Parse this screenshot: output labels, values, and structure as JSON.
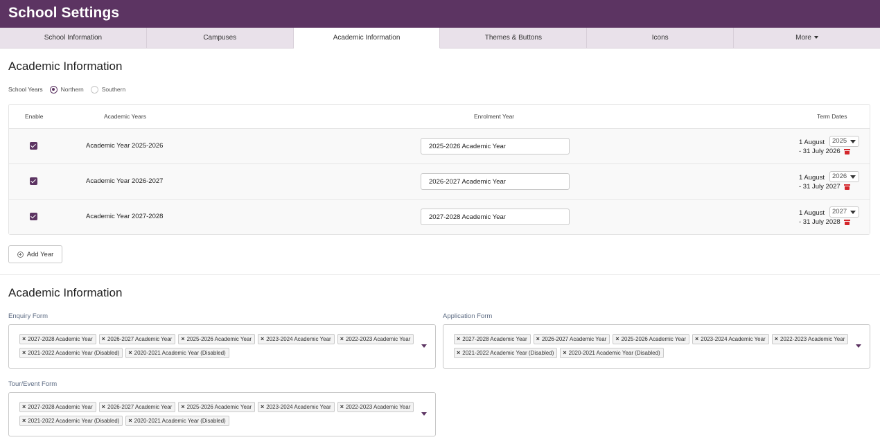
{
  "header": {
    "title": "School Settings"
  },
  "tabs": [
    {
      "label": "School Information",
      "active": false
    },
    {
      "label": "Campuses",
      "active": false
    },
    {
      "label": "Academic Information",
      "active": true
    },
    {
      "label": "Themes & Buttons",
      "active": false
    },
    {
      "label": "Icons",
      "active": false
    },
    {
      "label": "More",
      "active": false
    }
  ],
  "academic": {
    "title": "Academic Information",
    "school_years_label": "School Years",
    "hemisphere_options": [
      "Northern",
      "Southern"
    ],
    "hemisphere_selected": "Northern",
    "table": {
      "columns": {
        "enable": "Enable",
        "years": "Academic Years",
        "enrolment": "Enrolment Year",
        "terms": "Term Dates"
      },
      "rows": [
        {
          "enabled": true,
          "year": "Academic Year 2025-2026",
          "enrolment": "2025-2026 Academic Year",
          "term_start": "1 August",
          "start_year": "2025",
          "term_end": "-  31 July 2026"
        },
        {
          "enabled": true,
          "year": "Academic Year 2026-2027",
          "enrolment": "2026-2027 Academic Year",
          "term_start": "1 August",
          "start_year": "2026",
          "term_end": "-  31 July 2027"
        },
        {
          "enabled": true,
          "year": "Academic Year 2027-2028",
          "enrolment": "2027-2028 Academic Year",
          "term_start": "1 August",
          "start_year": "2027",
          "term_end": "-  31 July 2028"
        }
      ]
    },
    "add_year_label": "Add Year"
  },
  "forms_section": {
    "title": "Academic Information",
    "forms": [
      {
        "label": "Enquiry Form",
        "tags": [
          "2027-2028 Academic Year",
          "2026-2027 Academic Year",
          "2025-2026 Academic Year",
          "2023-2024 Academic Year",
          "2022-2023 Academic Year",
          "2021-2022 Academic Year (Disabled)",
          "2020-2021 Academic Year (Disabled)"
        ]
      },
      {
        "label": "Application Form",
        "tags": [
          "2027-2028 Academic Year",
          "2026-2027 Academic Year",
          "2025-2026 Academic Year",
          "2023-2024 Academic Year",
          "2022-2023 Academic Year",
          "2021-2022 Academic Year (Disabled)",
          "2020-2021 Academic Year (Disabled)"
        ]
      },
      {
        "label": "Tour/Event Form",
        "tags": [
          "2027-2028 Academic Year",
          "2026-2027 Academic Year",
          "2025-2026 Academic Year",
          "2023-2024 Academic Year",
          "2022-2023 Academic Year",
          "2021-2022 Academic Year (Disabled)",
          "2020-2021 Academic Year (Disabled)"
        ]
      }
    ]
  },
  "colors": {
    "brand": "#5c3462",
    "tab_bg": "#e9e1ea",
    "delete": "#d3262b",
    "label_blue": "#5b6a82"
  },
  "icons": {
    "checkbox": "checkbox-checked-icon",
    "delete": "trash-icon",
    "add": "plus-circle-icon",
    "remove_tag": "close-icon",
    "dropdown": "chevron-down-icon"
  }
}
